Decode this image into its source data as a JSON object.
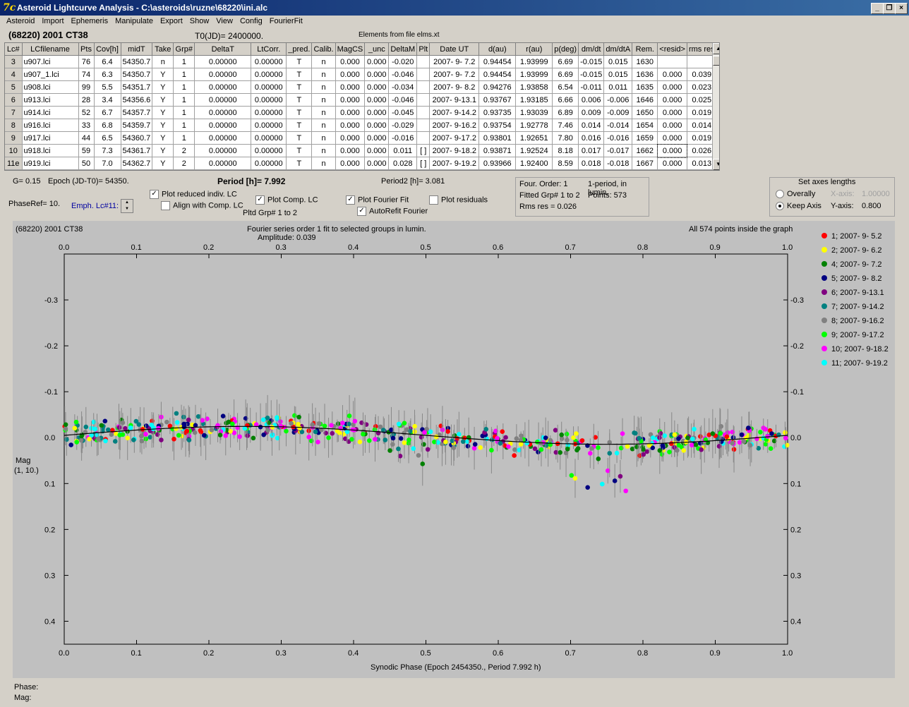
{
  "window": {
    "title": "Asteroid Lightcurve Analysis - C:\\asteroids\\ruzne\\68220\\ini.alc",
    "icon": "7c-app-icon"
  },
  "menu": [
    "Asteroid",
    "Import",
    "Ephemeris",
    "Manipulate",
    "Export",
    "Show",
    "View",
    "Config",
    "FourierFit"
  ],
  "header": {
    "asteroid": "(68220) 2001 CT38",
    "t0": "T0(JD)= 2400000.",
    "elements": "Elements from file elms.xt"
  },
  "table": {
    "columns": [
      "Lc#",
      "LCfilename",
      "Pts",
      "Cov[h]",
      "midT",
      "Take",
      "Grp#",
      "DeltaT",
      "LtCorr.",
      "_pred.",
      "Calib.",
      "MagCS",
      "_unc",
      "DeltaM",
      "Plt",
      "Date UT",
      "d(au)",
      "r(au)",
      "p(deg)",
      "dm/dt",
      "dm/dtA",
      "Rem.",
      "<resid>",
      "rms res"
    ],
    "rows": [
      [
        "3",
        "u907.lci",
        "76",
        "6.4",
        "54350.7",
        "n",
        "1",
        "0.00000",
        "0.00000",
        "T",
        "n",
        "0.000",
        "0.000",
        "-0.020",
        "",
        "2007- 9- 7.2",
        "0.94454",
        "1.93999",
        "6.69",
        "-0.015",
        "0.015",
        "1630",
        "",
        ""
      ],
      [
        "4",
        "u907_1.lci",
        "74",
        "6.3",
        "54350.7",
        "Y",
        "1",
        "0.00000",
        "0.00000",
        "T",
        "n",
        "0.000",
        "0.000",
        "-0.046",
        "",
        "2007- 9- 7.2",
        "0.94454",
        "1.93999",
        "6.69",
        "-0.015",
        "0.015",
        "1636",
        "0.000",
        "0.039"
      ],
      [
        "5",
        "u908.lci",
        "99",
        "5.5",
        "54351.7",
        "Y",
        "1",
        "0.00000",
        "0.00000",
        "T",
        "n",
        "0.000",
        "0.000",
        "-0.034",
        "",
        "2007- 9- 8.2",
        "0.94276",
        "1.93858",
        "6.54",
        "-0.011",
        "0.011",
        "1635",
        "0.000",
        "0.023"
      ],
      [
        "6",
        "u913.lci",
        "28",
        "3.4",
        "54356.6",
        "Y",
        "1",
        "0.00000",
        "0.00000",
        "T",
        "n",
        "0.000",
        "0.000",
        "-0.046",
        "",
        "2007- 9-13.1",
        "0.93767",
        "1.93185",
        "6.66",
        "0.006",
        "-0.006",
        "1646",
        "0.000",
        "0.025"
      ],
      [
        "7",
        "u914.lci",
        "52",
        "6.7",
        "54357.7",
        "Y",
        "1",
        "0.00000",
        "0.00000",
        "T",
        "n",
        "0.000",
        "0.000",
        "-0.045",
        "",
        "2007- 9-14.2",
        "0.93735",
        "1.93039",
        "6.89",
        "0.009",
        "-0.009",
        "1650",
        "0.000",
        "0.019"
      ],
      [
        "8",
        "u916.lci",
        "33",
        "6.8",
        "54359.7",
        "Y",
        "1",
        "0.00000",
        "0.00000",
        "T",
        "n",
        "0.000",
        "0.000",
        "-0.029",
        "",
        "2007- 9-16.2",
        "0.93754",
        "1.92778",
        "7.46",
        "0.014",
        "-0.014",
        "1654",
        "0.000",
        "0.014"
      ],
      [
        "9",
        "u917.lci",
        "44",
        "6.5",
        "54360.7",
        "Y",
        "1",
        "0.00000",
        "0.00000",
        "T",
        "n",
        "0.000",
        "0.000",
        "-0.016",
        "",
        "2007- 9-17.2",
        "0.93801",
        "1.92651",
        "7.80",
        "0.016",
        "-0.016",
        "1659",
        "0.000",
        "0.019"
      ],
      [
        "10",
        "u918.lci",
        "59",
        "7.3",
        "54361.7",
        "Y",
        "2",
        "0.00000",
        "0.00000",
        "T",
        "n",
        "0.000",
        "0.000",
        "0.011",
        "[ ]",
        "2007- 9-18.2",
        "0.93871",
        "1.92524",
        "8.18",
        "0.017",
        "-0.017",
        "1662",
        "0.000",
        "0.026"
      ],
      [
        "11e",
        "u919.lci",
        "50",
        "7.0",
        "54362.7",
        "Y",
        "2",
        "0.00000",
        "0.00000",
        "T",
        "n",
        "0.000",
        "0.000",
        "0.028",
        "[ ]",
        "2007- 9-19.2",
        "0.93966",
        "1.92400",
        "8.59",
        "0.018",
        "-0.018",
        "1667",
        "0.000",
        "0.013"
      ]
    ]
  },
  "controls": {
    "g": "G= 0.15",
    "epoch": "Epoch (JD-T0)= 54350.",
    "period": "Period [h]= 7.992",
    "period2": "Period2 [h]= 3.081",
    "phaseref": "PhaseRef= 10.",
    "emph": "Emph. Lc#11:",
    "plot_reduced": "Plot reduced indiv. LC",
    "align": "Align with Comp. LC",
    "plot_comp": "Plot Comp. LC",
    "pltd_grp": "Pltd Grp#  1   to   2",
    "plot_fourier": "Plot Fourier Fit",
    "autorefit": "AutoRefit Fourier",
    "plot_residuals": "Plot residuals",
    "four_order": "Four. Order:  1",
    "one_period": "1-period, in lumin.",
    "fitted": "Fitted Grp# 1 to 2",
    "points": "Points: 573",
    "rms": "Rms res     = 0.026",
    "axes_title": "Set axes lengths",
    "overally": "Overally",
    "keep_axis": "Keep Axis",
    "xaxis_label": "X-axis:",
    "xaxis_val": "1.00000",
    "yaxis_label": "Y-axis:",
    "yaxis_val": "0.800"
  },
  "plot": {
    "name": "(68220) 2001 CT38",
    "fourier_text": "Fourier series order 1 fit to selected groups in lumin.",
    "amplitude": "Amplitude: 0.039",
    "inside": "All 574 points inside the graph",
    "ylabel1": "Mag",
    "ylabel2": "(1, 10.)",
    "xlabel": "Synodic Phase (Epoch 2454350., Period 7.992 h)"
  },
  "chart_data": {
    "type": "scatter",
    "xlim": [
      0,
      1
    ],
    "ylim": [
      0.45,
      -0.4
    ],
    "xticks": [
      "0.0",
      "0.1",
      "0.2",
      "0.3",
      "0.4",
      "0.5",
      "0.6",
      "0.7",
      "0.8",
      "0.9",
      "1.0"
    ],
    "yticks": [
      "-0.3",
      "-0.2",
      "-0.1",
      "0.0",
      "0.1",
      "0.2",
      "0.3",
      "0.4"
    ],
    "y_inverted": true,
    "series": [
      {
        "name": "1; 2007- 9- 5.2",
        "color": "#ff0000"
      },
      {
        "name": "2; 2007- 9- 6.2",
        "color": "#ffff00"
      },
      {
        "name": "4; 2007- 9- 7.2",
        "color": "#008000"
      },
      {
        "name": "5; 2007- 9- 8.2",
        "color": "#000080"
      },
      {
        "name": "6; 2007- 9-13.1",
        "color": "#800080"
      },
      {
        "name": "7; 2007- 9-14.2",
        "color": "#008080"
      },
      {
        "name": "8; 2007- 9-16.2",
        "color": "#808080"
      },
      {
        "name": "9; 2007- 9-17.2",
        "color": "#00ff00"
      },
      {
        "name": "10; 2007- 9-18.2",
        "color": "#ff00ff"
      },
      {
        "name": "11; 2007- 9-19.2",
        "color": "#00ffff"
      }
    ],
    "fit_curve": {
      "mean": 0.0,
      "amplitude": 0.039,
      "peak_phase": 0.25
    },
    "grid": false,
    "legend": "right"
  },
  "status": {
    "phase": "Phase:",
    "mag": "Mag:"
  }
}
